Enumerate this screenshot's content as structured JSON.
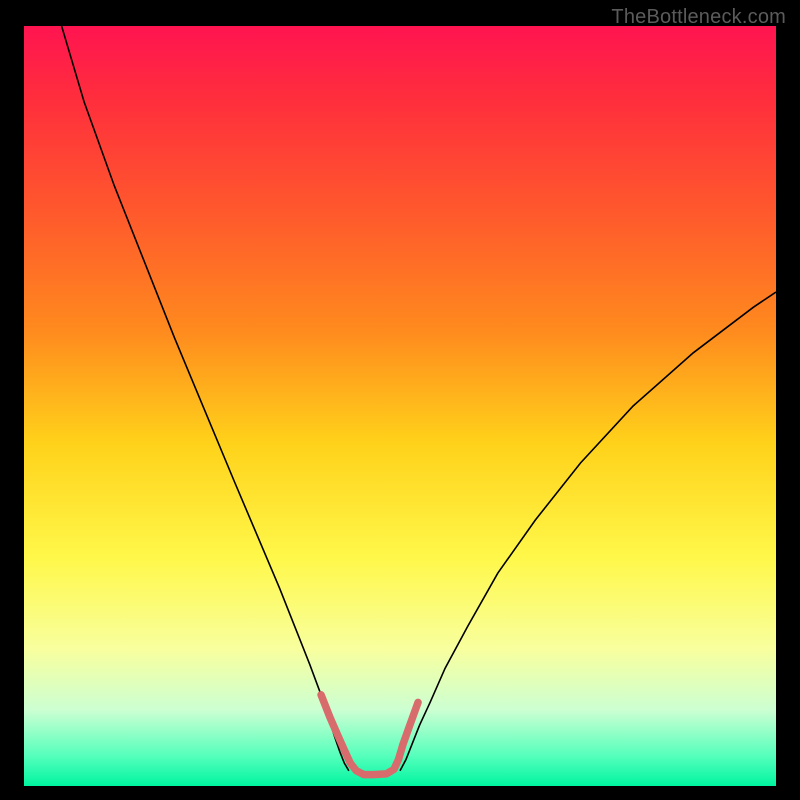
{
  "watermark": "TheBottleneck.com",
  "chart_data": {
    "type": "line",
    "title": "",
    "xlabel": "",
    "ylabel": "",
    "xlim": [
      0,
      100
    ],
    "ylim": [
      0,
      100
    ],
    "grid": false,
    "legend": false,
    "background_gradient": {
      "stops": [
        {
          "offset": 0.0,
          "color": "#ff1450"
        },
        {
          "offset": 0.1,
          "color": "#ff2f3c"
        },
        {
          "offset": 0.25,
          "color": "#ff5a2c"
        },
        {
          "offset": 0.4,
          "color": "#ff8a1e"
        },
        {
          "offset": 0.55,
          "color": "#ffd21a"
        },
        {
          "offset": 0.7,
          "color": "#fff84a"
        },
        {
          "offset": 0.82,
          "color": "#f8ff9e"
        },
        {
          "offset": 0.9,
          "color": "#ccffd2"
        },
        {
          "offset": 0.96,
          "color": "#56ffbc"
        },
        {
          "offset": 1.0,
          "color": "#00f5a0"
        }
      ]
    },
    "series": [
      {
        "name": "left-branch",
        "color": "#000000",
        "stroke_width": 1.6,
        "x": [
          5,
          8,
          12,
          16,
          20,
          24,
          28,
          31,
          34,
          36,
          38,
          39.5,
          40.5,
          41.3,
          42,
          42.6,
          43.2
        ],
        "y": [
          100,
          90,
          79,
          69,
          59,
          49.5,
          40,
          33,
          26,
          21,
          16,
          12,
          9,
          6.5,
          4.5,
          3,
          2
        ]
      },
      {
        "name": "right-branch",
        "color": "#000000",
        "stroke_width": 1.6,
        "x": [
          50,
          50.8,
          51.6,
          52.6,
          54,
          56,
          59,
          63,
          68,
          74,
          81,
          89,
          97,
          100
        ],
        "y": [
          2,
          3.5,
          5.5,
          8,
          11,
          15.5,
          21,
          28,
          35,
          42.5,
          50,
          57,
          63,
          65
        ]
      },
      {
        "name": "highlight-bottom",
        "color": "#d86b6b",
        "stroke_width": 7.5,
        "linecap": "round",
        "x": [
          39.5,
          40.7,
          41.8,
          42.7,
          43.4,
          44.2,
          45.2,
          46.5,
          48.2,
          49.2,
          49.8,
          50.4,
          51.3,
          52.4
        ],
        "y": [
          12,
          9,
          6.5,
          4.5,
          3,
          2,
          1.5,
          1.5,
          1.6,
          2.2,
          3.5,
          5.5,
          8,
          11
        ]
      }
    ]
  }
}
